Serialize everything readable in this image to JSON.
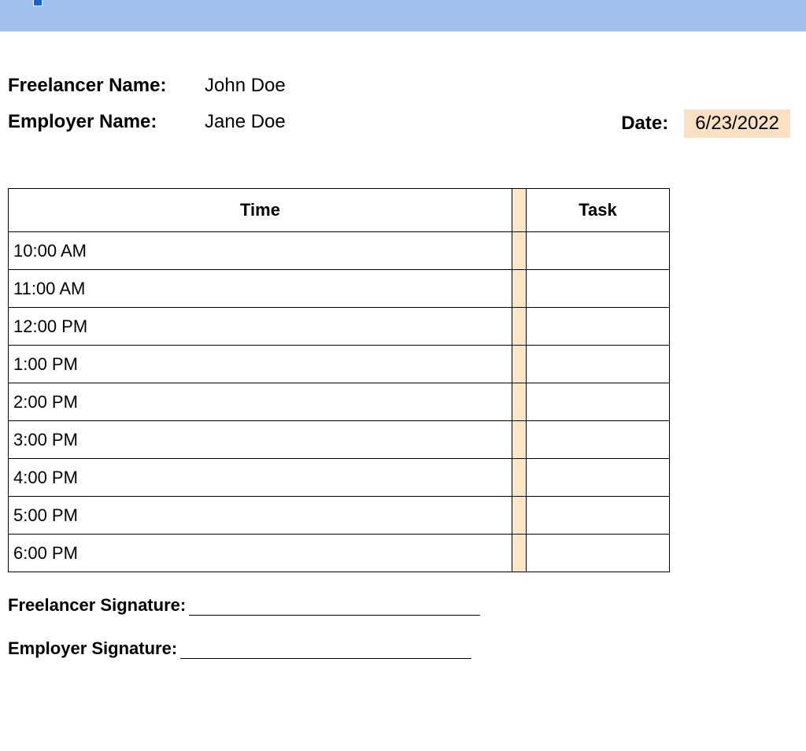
{
  "header": {
    "freelancer_label": "Freelancer Name:",
    "freelancer_value": "John Doe",
    "employer_label": "Employer Name:",
    "employer_value": "Jane Doe",
    "date_label": "Date:",
    "date_value": "6/23/2022"
  },
  "table": {
    "columns": {
      "time": "Time",
      "task": "Task"
    },
    "rows": [
      {
        "time": "10:00 AM",
        "task": ""
      },
      {
        "time": "11:00 AM",
        "task": ""
      },
      {
        "time": "12:00 PM",
        "task": ""
      },
      {
        "time": "1:00 PM",
        "task": ""
      },
      {
        "time": "2:00 PM",
        "task": ""
      },
      {
        "time": "3:00 PM",
        "task": ""
      },
      {
        "time": "4:00 PM",
        "task": ""
      },
      {
        "time": "5:00 PM",
        "task": ""
      },
      {
        "time": "6:00 PM",
        "task": ""
      }
    ]
  },
  "signatures": {
    "freelancer_label": "Freelancer Signature:",
    "employer_label": "Employer Signature:"
  }
}
